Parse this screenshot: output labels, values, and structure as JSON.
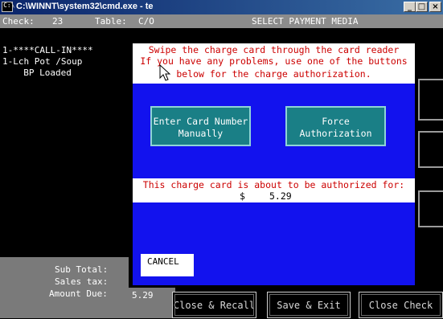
{
  "window": {
    "title": "C:\\WINNT\\system32\\cmd.exe - te",
    "icon": "cmd-icon"
  },
  "header": {
    "check_label": "Check:",
    "check_no": "23",
    "table_label": "Table:",
    "table_no": "C/O",
    "screen_title": "SELECT PAYMENT MEDIA"
  },
  "order": {
    "items": [
      "1-****CALL-IN****",
      "1-Lch Pot /Soup",
      "  BP Loaded"
    ]
  },
  "totals": {
    "sub_total_label": "Sub Total:",
    "sales_tax_label": "Sales tax:",
    "amount_due_label": "Amount Due:",
    "amount_due_value": "5.29"
  },
  "dialog": {
    "line1": "Swipe the charge card through the card reader",
    "line2": "If you have any problems, use one of the buttons",
    "line3": "below for the charge authorization.",
    "btn_manual_line1": "Enter Card Number",
    "btn_manual_line2": "Manually",
    "btn_force_line1": "Force",
    "btn_force_line2": "Authorization",
    "auth_text": "This charge card is about to be authorized for:",
    "currency": "$",
    "amount": "5.29",
    "cancel": "CANCEL"
  },
  "bottom": {
    "close_recall": "Close & Recall",
    "save_exit": "Save & Exit",
    "close_check": "Close Check"
  },
  "colors": {
    "dialog_blue": "#1212ee",
    "teal": "#1a7f86",
    "red_text": "#cc0000",
    "header_gray": "#8c8c8c"
  }
}
